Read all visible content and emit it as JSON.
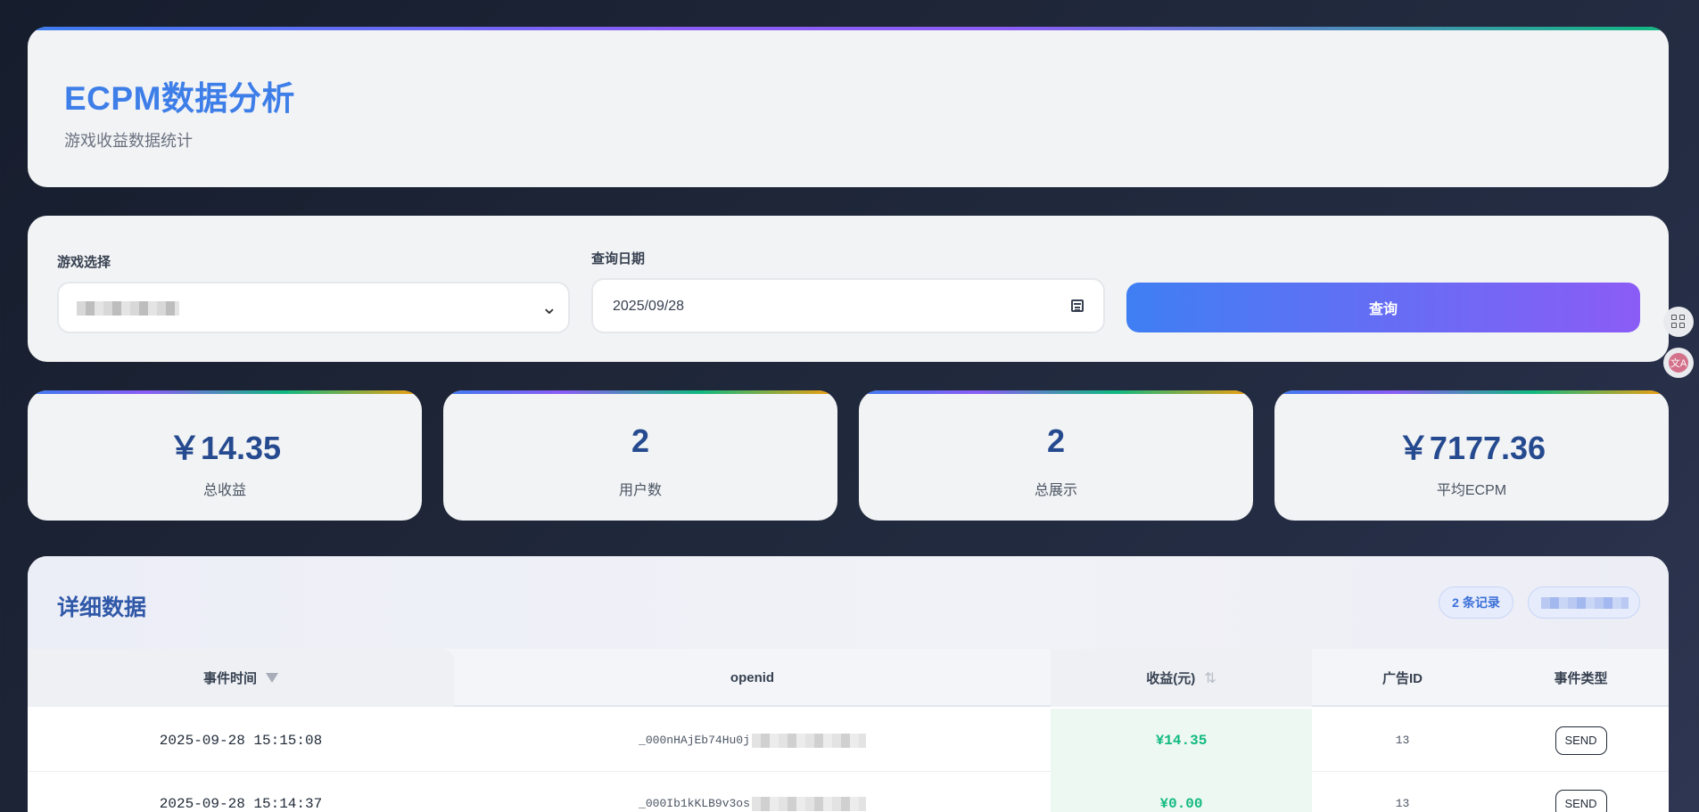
{
  "header": {
    "title": "ECPM数据分析",
    "subtitle": "游戏收益数据统计"
  },
  "filters": {
    "game_label": "游戏选择",
    "date_label": "查询日期",
    "date_value": "2025/09/28",
    "query_label": "查询"
  },
  "stats": [
    {
      "value": "￥14.35",
      "label": "总收益"
    },
    {
      "value": "2",
      "label": "用户数"
    },
    {
      "value": "2",
      "label": "总展示"
    },
    {
      "value": "￥7177.36",
      "label": "平均ECPM"
    }
  ],
  "table": {
    "title": "详细数据",
    "count_badge": "2 条记录",
    "columns": {
      "time": "事件时间",
      "openid": "openid",
      "revenue": "收益(元)",
      "ad_id": "广告ID",
      "type": "事件类型"
    },
    "rows": [
      {
        "time": "2025-09-28 15:15:08",
        "openid": "_000nHAjEb74Hu0j",
        "revenue": "¥14.35",
        "ad_id": "13",
        "type": "SEND"
      },
      {
        "time": "2025-09-28 15:14:37",
        "openid": "_000Ib1kKLB9v3os",
        "revenue": "¥0.00",
        "ad_id": "13",
        "type": "SEND"
      }
    ]
  },
  "side_widgets": {
    "translate_glyph": "文A"
  }
}
